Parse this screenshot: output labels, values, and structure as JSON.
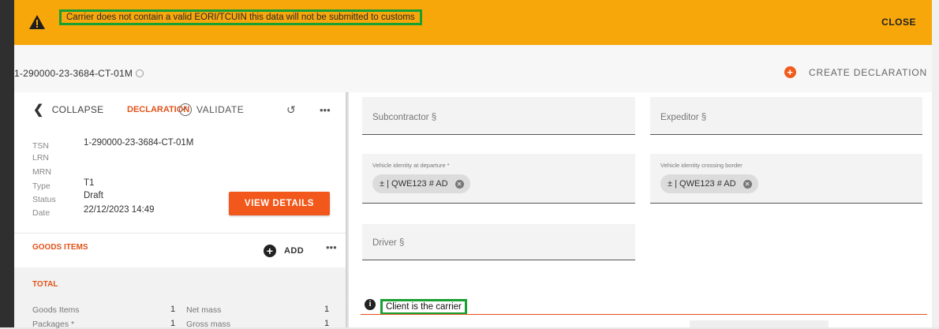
{
  "banner": {
    "message": "Carrier does not contain a valid EORI/TCUIN this data will not be submitted to customs",
    "close_label": "CLOSE",
    "color": "#f7a70a"
  },
  "header": {
    "reference": "1-290000-23-3684-CT-01M",
    "create_label": "CREATE DECLARATION"
  },
  "toolbar": {
    "collapse_label": "COLLAPSE",
    "declaration_label": "DECLARATION",
    "validate_label": "VALIDATE"
  },
  "meta": {
    "tsn_label": "TSN",
    "tsn": "1-290000-23-3684-CT-01M",
    "lrn_label": "LRN",
    "mrn_label": "MRN",
    "type_label": "Type",
    "type": "T1",
    "status_label": "Status",
    "status": "Draft",
    "date_label": "Date",
    "date": "22/12/2023 14:49",
    "view_details_label": "VIEW DETAILS"
  },
  "goods": {
    "title": "GOODS ITEMS",
    "add_label": "ADD"
  },
  "total": {
    "title": "TOTAL",
    "goods_items_label": "Goods Items",
    "goods_items": "1",
    "net_mass_label": "Net mass",
    "net_mass": "1",
    "packages_label": "Packages *",
    "packages": "1",
    "gross_mass_label": "Gross mass",
    "gross_mass": "1"
  },
  "form": {
    "subcontractor_placeholder": "Subcontractor §",
    "expeditor_placeholder": "Expeditor §",
    "vehicle_departure_label": "Vehicle identity at departure *",
    "vehicle_departure_value": "± | QWE123 # AD",
    "vehicle_border_label": "Vehicle identity crossing border",
    "vehicle_border_value": "± | QWE123 # AD",
    "driver_placeholder": "Driver §"
  },
  "notice": {
    "message": "Client is the carrier"
  },
  "colors": {
    "accent": "#f2581b",
    "highlight": "#18a033"
  }
}
